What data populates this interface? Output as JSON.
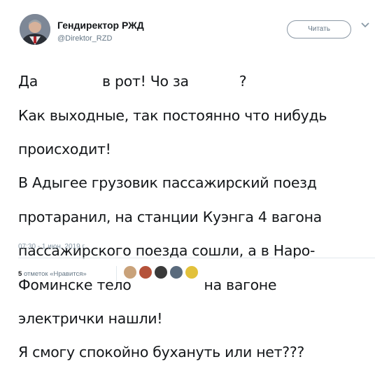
{
  "header": {
    "display_name": "Гендиректор РЖД",
    "handle": "@Direktor_RZD",
    "follow_label": "Читать",
    "avatar_icon": "user-avatar-icon",
    "caret_icon": "chevron-down-icon"
  },
  "tweet": {
    "lines": [
      {
        "a": "Да",
        "b": "в рот! Чо за",
        "c": "?"
      },
      {
        "text": "Как выходные, так постоянно что нибудь"
      },
      {
        "text": "происходит!"
      },
      {
        "text": "В Адыгее грузовик пассажирский поезд"
      },
      {
        "text": "протаранил, на станции Куэнга 4 вагона"
      },
      {
        "text": "пассажирского поезда сошли, а в Наро-"
      },
      {
        "a": "Фоминске тело",
        "b": "на вагоне"
      },
      {
        "text": "электрички нашли!"
      },
      {
        "text": "Я смогу спокойно бухануть или нет???"
      }
    ]
  },
  "meta": {
    "timestamp": "07:30 - 1 июн. 2019 г."
  },
  "engagement": {
    "likes_count": "5",
    "likes_label": "отметок «Нравится»",
    "liker_avatar_colors": [
      "#c9a27a",
      "#b5523a",
      "#3a3a3a",
      "#5a6b7d",
      "#e2c13b"
    ]
  }
}
